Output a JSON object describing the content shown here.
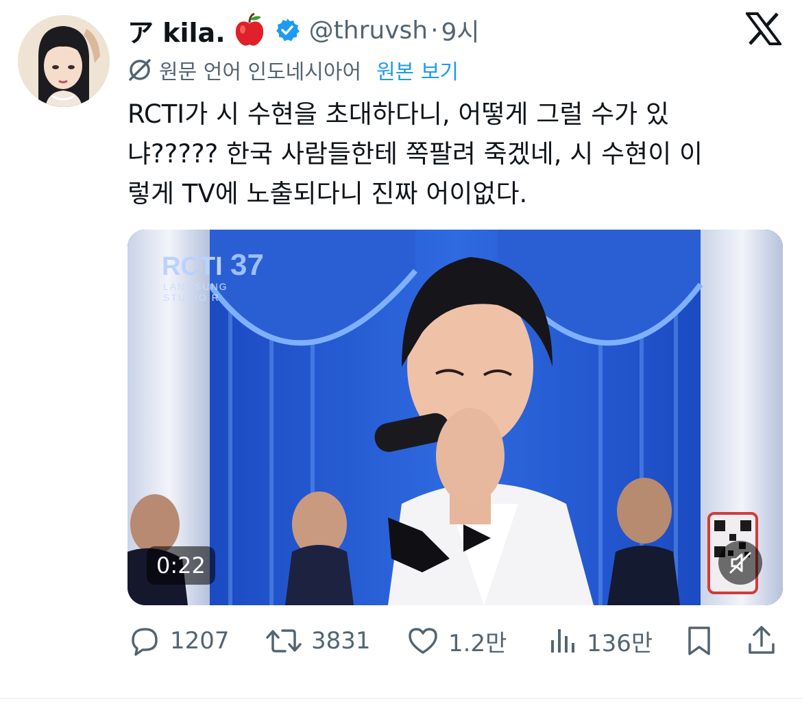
{
  "author": {
    "display_name": "ア kila.",
    "handle": "@thruvsh",
    "separator": "·",
    "time": "9시"
  },
  "translation": {
    "note": "원문 언어 인도네시아어",
    "view_original": "원본 보기"
  },
  "tweet": {
    "lines": [
      "RCTI가 시 수현을 초대하다니, 어떻게 그럴 수가 있",
      "냐????? 한국 사람들한테 쪽팔려 죽겠네, 시 수현이 이",
      "렇게 TV에 노출되다니 진짜 어이없다."
    ]
  },
  "media": {
    "duration": "0:22",
    "channel_logo_main": "RCTI",
    "channel_logo_sub1": "LANGSUNG",
    "channel_logo_sub2": "STUDIO R"
  },
  "actions": {
    "replies": "1207",
    "retweets": "3831",
    "likes": "1.2만",
    "views": "136만"
  },
  "colors": {
    "secondary_text": "#536471",
    "link": "#1d9bf0",
    "verified": "#1d9bf0",
    "primary_text": "#0f1419"
  },
  "icons": [
    "apple-emoji-icon",
    "verified-badge-icon",
    "x-logo-icon",
    "translate-icon",
    "mute-icon",
    "reply-icon",
    "retweet-icon",
    "like-icon",
    "views-icon",
    "bookmark-icon",
    "share-icon"
  ]
}
